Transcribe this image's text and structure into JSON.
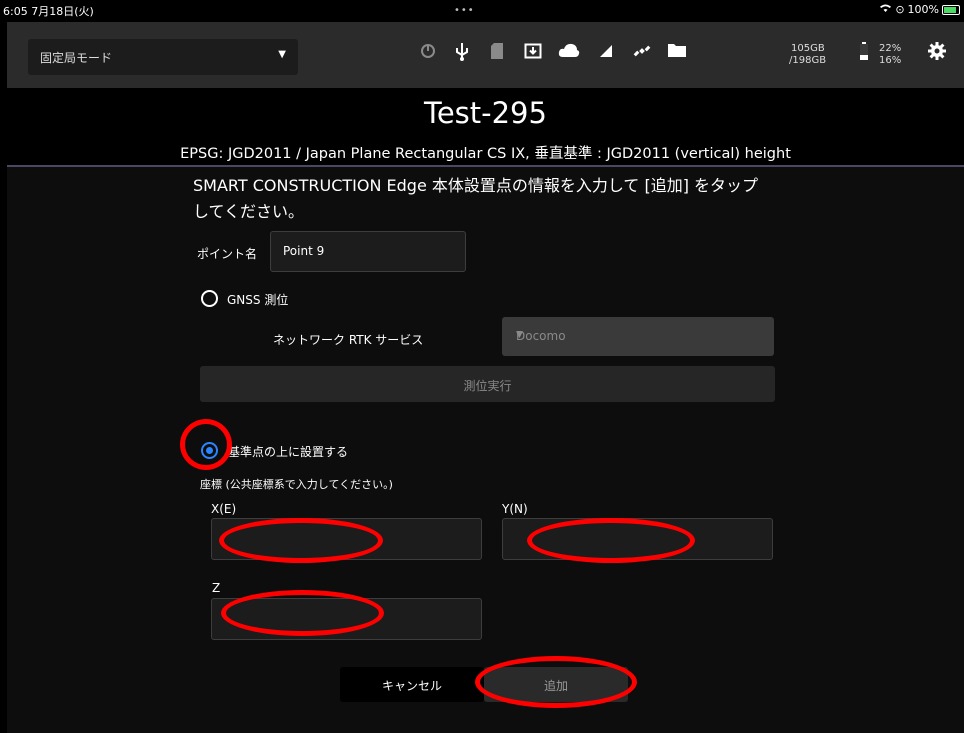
{
  "status": {
    "time_date": "6:05  7月18日(火)",
    "dots": "•••",
    "wifi_icon": "wifi-icon",
    "battery_text": "100%"
  },
  "toolbar": {
    "mode_label": "固定局モード",
    "storage_used": "105GB",
    "storage_total": "/198GB",
    "battery_pct1": "22%",
    "battery_pct2": "16%",
    "icons": [
      "refresh-warning-icon",
      "usb-icon",
      "sd-card-icon",
      "download-box-icon",
      "cloud-icon",
      "signal-icon",
      "satellite-icon",
      "folder-icon",
      "battery-icon",
      "gear-icon"
    ]
  },
  "header": {
    "title": "Test-295",
    "subtitle": "EPSG: JGD2011 / Japan Plane Rectangular CS IX, 垂直基準 : JGD2011 (vertical) height"
  },
  "form": {
    "instruction_line1": "SMART CONSTRUCTION Edge 本体設置点の情報を入力して [追加] をタップ",
    "instruction_line2": "してください。",
    "point_name_label": "ポイント名",
    "point_name_value": "Point 9",
    "gnss_label": "GNSS 測位",
    "gnss_selected": false,
    "network_rtk_label": "ネットワーク RTK サービス",
    "network_rtk_value": "Docomo",
    "measure_button": "測位実行",
    "ref_point_label": "基準点の上に設置する",
    "ref_point_selected": true,
    "coord_label": "座標  (公共座標系で入力してください。)",
    "x_label": "X(E)",
    "y_label": "Y(N)",
    "z_label": "Z",
    "x_value": "",
    "y_value": "",
    "z_value": "",
    "cancel_button": "キャンセル",
    "add_button": "追加"
  },
  "colors": {
    "accent": "#2a85ff",
    "annotation": "#ff0000",
    "topbar": "#2b2b2b"
  }
}
